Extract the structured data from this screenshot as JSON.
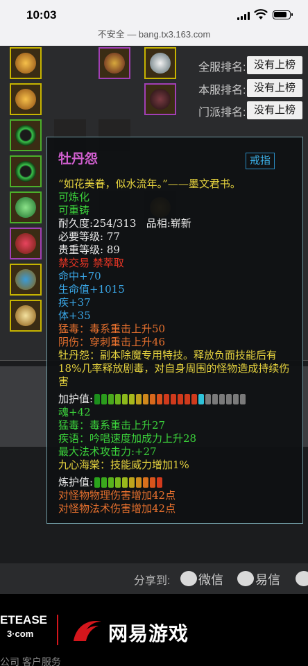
{
  "status_bar": {
    "time": "10:03"
  },
  "address_bar": {
    "text": "不安全 — bang.tx3.163.com"
  },
  "ranks": [
    {
      "label": "全服排名:",
      "value": "没有上榜"
    },
    {
      "label": "本服排名:",
      "value": "没有上榜"
    },
    {
      "label": "门派排名:",
      "value": "没有上榜"
    }
  ],
  "tooltip": {
    "title": "牡丹怨",
    "button": "戒指",
    "quote": "“如花美眷，似水流年。”——墨文君书。",
    "refinable": "可炼化",
    "recastable": "可重铸",
    "durability_label": "耐久度:",
    "durability_value": "254/313",
    "quality_label": "品相:",
    "quality_value": "崭新",
    "level_label": "必要等级:",
    "level_value": "77",
    "rarity_label": "贵重等级:",
    "rarity_value": "89",
    "restriction": "禁交易 禁萃取",
    "stats": [
      "命中+70",
      "生命值+1015",
      "疾+37",
      "体+35"
    ],
    "effects": [
      "猛毒：毒系重击上升50",
      "阴伤：穿刺重击上升46"
    ],
    "special": "牡丹怨：副本除魔专用特技。释放负面技能后有18%几率释放剧毒，对自身周围的怪物造成持续伤害",
    "protect_label": "加护值:",
    "protect_segments": 22,
    "protect_filled": 16,
    "protect_stats": [
      "魂+42",
      "猛毒：毒系重击上升27",
      "疾语：吟唱速度加成力上升28",
      "最大法术攻击力:+27"
    ],
    "protect_special": "九心海棠：技能威力增加1%",
    "refine_label": "炼护值:",
    "refine_segments": 10,
    "refine_filled": 10,
    "refine_stats": [
      "对怪物物理伤害增加42点",
      "对怪物法术伤害增加42点"
    ]
  },
  "share": {
    "label": "分享到:",
    "items": [
      "微信",
      "易信"
    ]
  },
  "footer": {
    "netease_top": "ETEASE",
    "netease_bottom": "3·com",
    "game_name": "网易游戏",
    "bottom_text": "公司    客户服务      "
  },
  "colors": {
    "title": "#d15fcf",
    "green": "#3bd23b",
    "red": "#e93525",
    "blue": "#3aa6e6",
    "orange": "#e8712e",
    "yellow": "#e5d23e"
  }
}
